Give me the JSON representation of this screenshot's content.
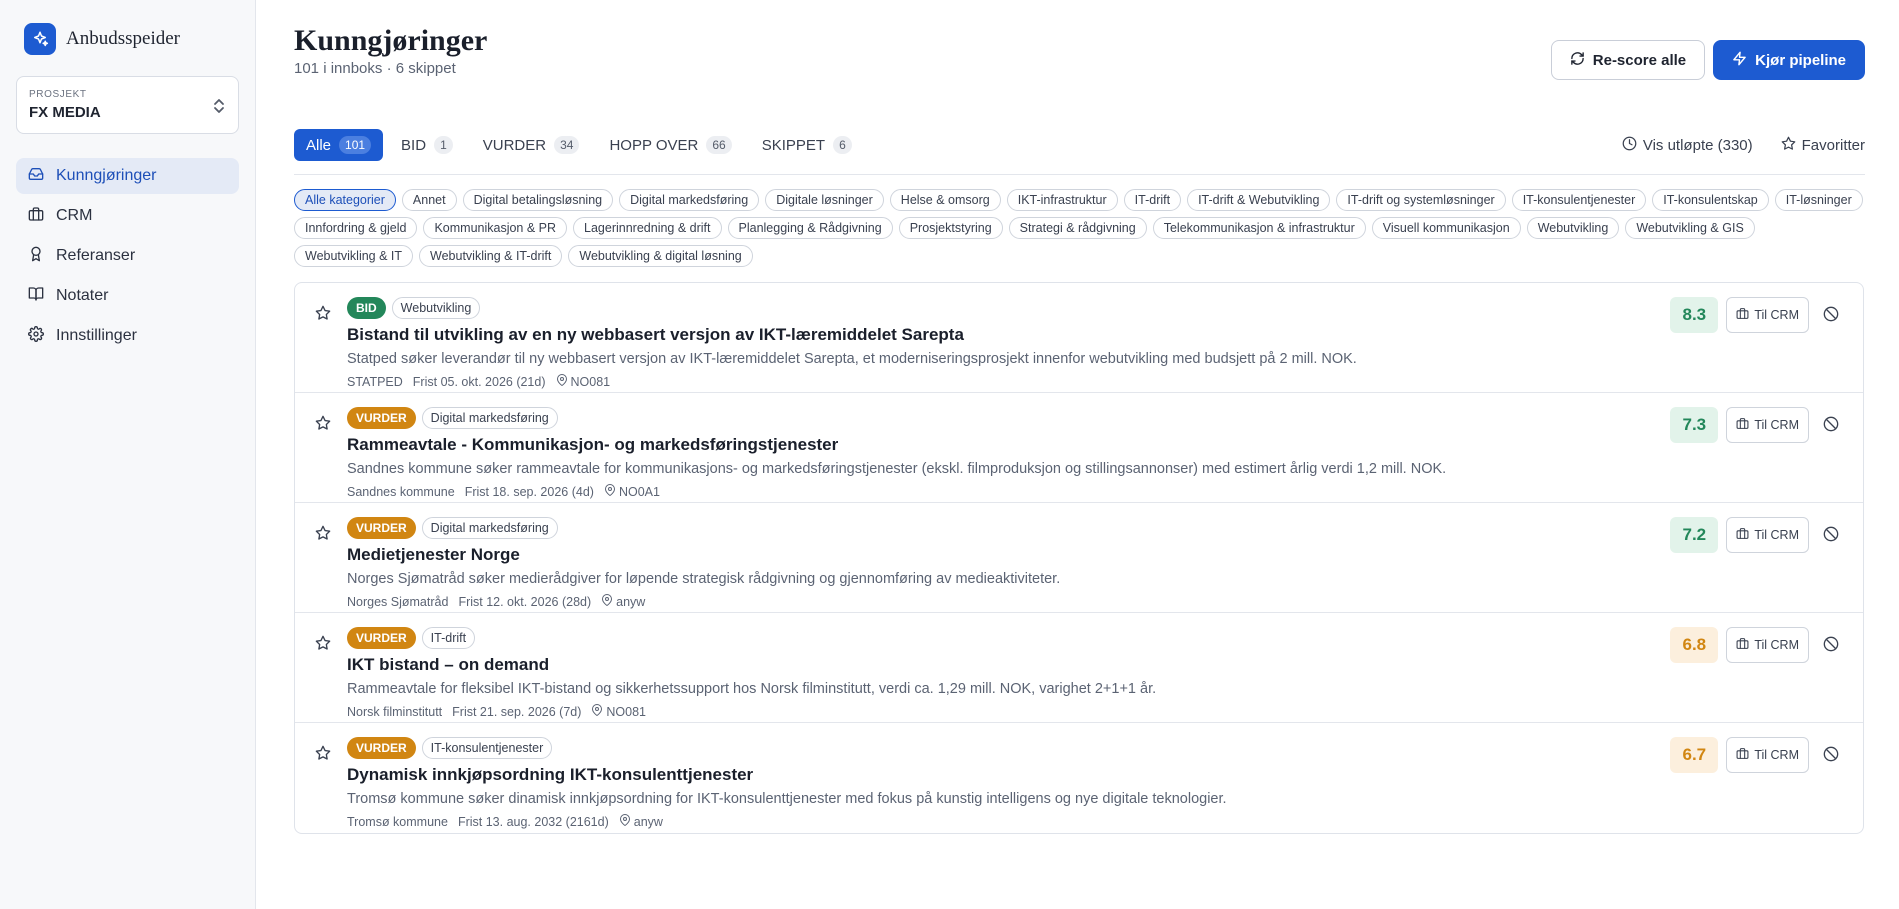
{
  "brand": {
    "name": "Anbudsspeider"
  },
  "project": {
    "label": "PROSJEKT",
    "name": "FX MEDIA"
  },
  "nav": [
    {
      "label": "Kunngjøringer",
      "icon": "inbox-icon",
      "active": true
    },
    {
      "label": "CRM",
      "icon": "briefcase-icon",
      "active": false
    },
    {
      "label": "Referanser",
      "icon": "award-icon",
      "active": false
    },
    {
      "label": "Notater",
      "icon": "book-icon",
      "active": false
    },
    {
      "label": "Innstillinger",
      "icon": "gear-icon",
      "active": false
    }
  ],
  "header": {
    "title": "Kunngjøringer",
    "subtitle": "101 i innboks · 6 skippet",
    "rescore_label": "Re-score alle",
    "pipeline_label": "Kjør pipeline"
  },
  "tabs": [
    {
      "label": "Alle",
      "count": "101",
      "active": true
    },
    {
      "label": "BID",
      "count": "1",
      "active": false
    },
    {
      "label": "VURDER",
      "count": "34",
      "active": false
    },
    {
      "label": "HOPP OVER",
      "count": "66",
      "active": false
    },
    {
      "label": "SKIPPET",
      "count": "6",
      "active": false
    }
  ],
  "tab_links": {
    "expired": "Vis utløpte (330)",
    "favorites": "Favoritter"
  },
  "categories": [
    "Alle kategorier",
    "Annet",
    "Digital betalingsløsning",
    "Digital markedsføring",
    "Digitale løsninger",
    "Helse & omsorg",
    "IKT-infrastruktur",
    "IT-drift",
    "IT-drift & Webutvikling",
    "IT-drift og systemløsninger",
    "IT-konsulentjenester",
    "IT-konsulentskap",
    "IT-løsninger",
    "Innfordring & gjeld",
    "Kommunikasjon & PR",
    "Lagerinnredning & drift",
    "Planlegging & Rådgivning",
    "Prosjektstyring",
    "Strategi & rådgivning",
    "Telekommunikasjon & infrastruktur",
    "Visuell kommunikasjon",
    "Webutvikling",
    "Webutvikling & GIS",
    "Webutvikling & IT",
    "Webutvikling & IT-drift",
    "Webutvikling & digital løsning"
  ],
  "items": [
    {
      "badge": "BID",
      "badge_type": "bid",
      "category": "Webutvikling",
      "title": "Bistand til utvikling av en ny webbasert versjon av IKT-læremiddelet Sarepta",
      "description": "Statped søker leverandør til ny webbasert versjon av IKT-læremiddelet Sarepta, et moderniseringsprosjekt innenfor webutvikling med budsjett på 2 mill. NOK.",
      "buyer": "STATPED",
      "deadline": "Frist 05. okt. 2026 (21d)",
      "location": "NO081",
      "score": "8.3",
      "score_color": "green",
      "crm_label": "Til CRM"
    },
    {
      "badge": "VURDER",
      "badge_type": "vurder",
      "category": "Digital markedsføring",
      "title": "Rammeavtale - Kommunikasjon- og markedsføringstjenester",
      "description": "Sandnes kommune søker rammeavtale for kommunikasjons- og markedsføringstjenester (ekskl. filmproduksjon og stillingsannonser) med estimert årlig verdi 1,2 mill. NOK.",
      "buyer": "Sandnes kommune",
      "deadline": "Frist 18. sep. 2026 (4d)",
      "location": "NO0A1",
      "score": "7.3",
      "score_color": "green",
      "crm_label": "Til CRM"
    },
    {
      "badge": "VURDER",
      "badge_type": "vurder",
      "category": "Digital markedsføring",
      "title": "Medietjenester Norge",
      "description": "Norges Sjømatråd søker medierådgiver for løpende strategisk rådgivning og gjennomføring av medieaktiviteter.",
      "buyer": "Norges Sjømatråd",
      "deadline": "Frist 12. okt. 2026 (28d)",
      "location": "anyw",
      "score": "7.2",
      "score_color": "green",
      "crm_label": "Til CRM"
    },
    {
      "badge": "VURDER",
      "badge_type": "vurder",
      "category": "IT-drift",
      "title": "IKT bistand – on demand",
      "description": "Rammeavtale for fleksibel IKT-bistand og sikkerhetssupport hos Norsk filminstitutt, verdi ca. 1,29 mill. NOK, varighet 2+1+1 år.",
      "buyer": "Norsk filminstitutt",
      "deadline": "Frist 21. sep. 2026 (7d)",
      "location": "NO081",
      "score": "6.8",
      "score_color": "orange",
      "crm_label": "Til CRM"
    },
    {
      "badge": "VURDER",
      "badge_type": "vurder",
      "category": "IT-konsulentjenester",
      "title": "Dynamisk innkjøpsordning IKT-konsulenttjenester",
      "description": "Tromsø kommune søker dinamisk innkjøpsordning for IKT-konsulenttjenester med fokus på kunstig intelligens og nye digitale teknologier.",
      "buyer": "Tromsø kommune",
      "deadline": "Frist 13. aug. 2032 (2161d)",
      "location": "anyw",
      "score": "6.7",
      "score_color": "orange",
      "crm_label": "Til CRM"
    }
  ],
  "colors": {
    "accent": "#1d5bd1",
    "bid": "#23875a",
    "vurder": "#d18612"
  }
}
